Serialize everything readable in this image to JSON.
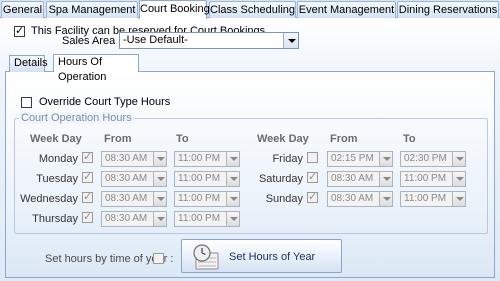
{
  "top_tabs": [
    "General",
    "Spa Management",
    "Court Booking",
    "Class Scheduling",
    "Event Management",
    "Dining Reservations"
  ],
  "active_top_tab": "Court Booking",
  "facility_checkbox": {
    "label": "This Facility can be reserved for Court Bookings",
    "checked": true
  },
  "sales_area": {
    "label": "Sales Area :",
    "value": "-Use Default-"
  },
  "inner_tabs": [
    "Details",
    "Hours Of Operation"
  ],
  "active_inner_tab": "Hours Of Operation",
  "override_checkbox": {
    "label": "Override Court Type Hours",
    "checked": false
  },
  "group_title": "Court Operation Hours",
  "headers": {
    "week_day": "Week Day",
    "from": "From",
    "to": "To"
  },
  "days": [
    {
      "name": "Monday",
      "checked": true,
      "from": "08:30 AM",
      "to": "11:00 PM"
    },
    {
      "name": "Tuesday",
      "checked": true,
      "from": "08:30 AM",
      "to": "11:00 PM"
    },
    {
      "name": "Wednesday",
      "checked": true,
      "from": "08:30 AM",
      "to": "11:00 PM"
    },
    {
      "name": "Thursday",
      "checked": true,
      "from": "08:30 AM",
      "to": "11:00 PM"
    },
    {
      "name": "Friday",
      "checked": false,
      "from": "02:15 PM",
      "to": "02:30 PM"
    },
    {
      "name": "Saturday",
      "checked": true,
      "from": "08:30 AM",
      "to": "11:00 PM"
    },
    {
      "name": "Sunday",
      "checked": true,
      "from": "08:30 AM",
      "to": "11:00 PM"
    }
  ],
  "year_hours": {
    "label": "Set hours by time of year :",
    "checked": false
  },
  "set_hours_button": "Set Hours of Year",
  "icons": {
    "set_hours_button": "clock-calendar-icon"
  }
}
